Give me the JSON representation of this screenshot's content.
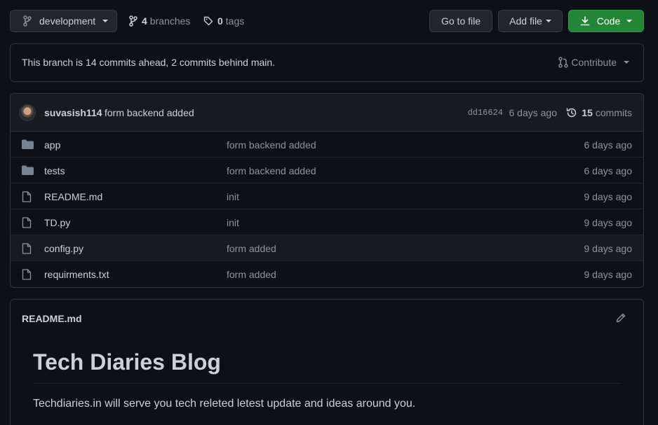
{
  "topbar": {
    "branch_label": "development",
    "branches_count": "4",
    "branches_label": "branches",
    "tags_count": "0",
    "tags_label": "tags",
    "goto_label": "Go to file",
    "add_label": "Add file",
    "code_label": "Code"
  },
  "branch_info": {
    "message": "This branch is 14 commits ahead, 2 commits behind main.",
    "contribute_label": "Contribute"
  },
  "latest_commit": {
    "author": "suvasish114",
    "message": "form backend added",
    "sha": "dd16624",
    "time": "6 days ago",
    "count": "15",
    "count_label": "commits"
  },
  "files": [
    {
      "name": "app",
      "type": "folder",
      "message": "form backend added",
      "time": "6 days ago"
    },
    {
      "name": "tests",
      "type": "folder",
      "message": "form backend added",
      "time": "6 days ago"
    },
    {
      "name": "README.md",
      "type": "file",
      "message": "init",
      "time": "9 days ago"
    },
    {
      "name": "TD.py",
      "type": "file",
      "message": "init",
      "time": "9 days ago"
    },
    {
      "name": "config.py",
      "type": "file",
      "message": "form added",
      "time": "9 days ago"
    },
    {
      "name": "requirments.txt",
      "type": "file",
      "message": "form added",
      "time": "9 days ago"
    }
  ],
  "readme": {
    "filename": "README.md",
    "heading": "Tech Diaries Blog",
    "paragraph": "Techdiaries.in will serve you tech releted letest update and ideas around you."
  },
  "colors": {
    "background": "#0d1117",
    "border": "#30363d",
    "code_button": "#238636",
    "muted_text": "#8b949e",
    "text": "#c9d1d9"
  }
}
